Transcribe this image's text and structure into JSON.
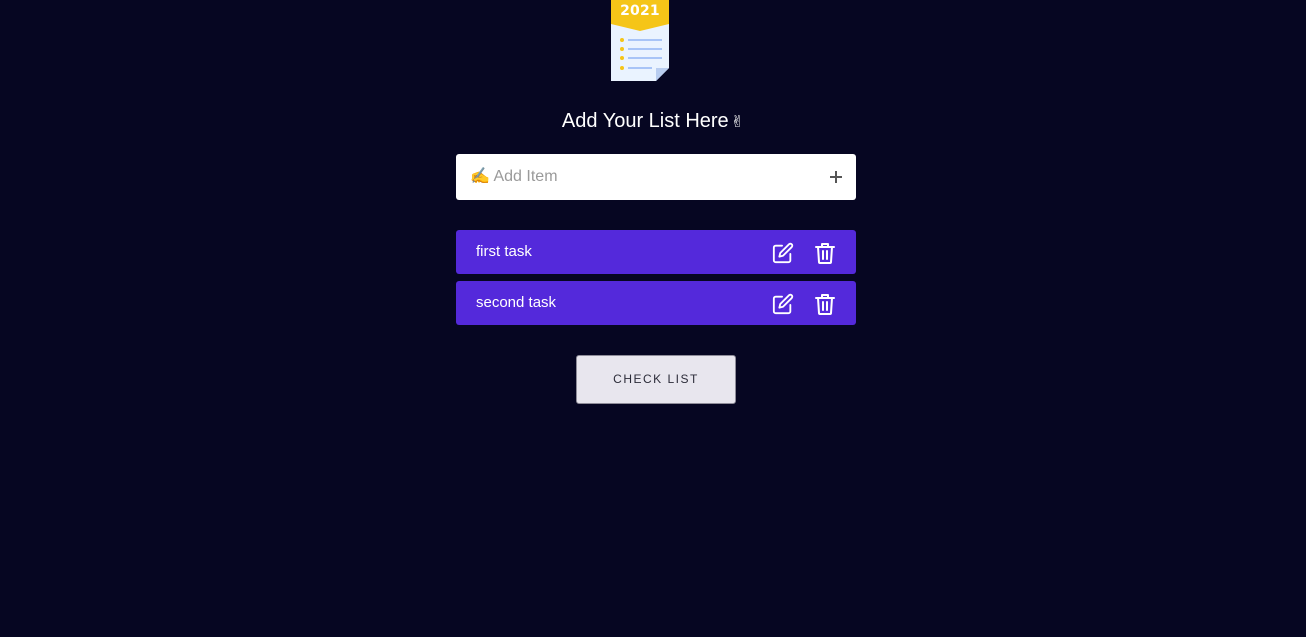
{
  "logo": {
    "year": "2021",
    "icon": "checklist-document-icon",
    "colors": {
      "banner": "#f5c518",
      "paper": "#eaf3ff",
      "lines": "#a8c4f7",
      "bullets": "#f5c518"
    }
  },
  "heading": {
    "text": "Add Your List Here",
    "emoji": "✌"
  },
  "add_item": {
    "placeholder": "✍ Add Item",
    "value": "",
    "add_icon": "plus-icon"
  },
  "tasks": [
    {
      "label": "first task",
      "edit_icon": "edit-icon",
      "delete_icon": "trash-icon"
    },
    {
      "label": "second task",
      "edit_icon": "edit-icon",
      "delete_icon": "trash-icon"
    }
  ],
  "check_list_button": {
    "label": "CHECK LIST"
  },
  "colors": {
    "background": "#060622",
    "task_background": "#5429db",
    "button_background": "#e8e6ee"
  }
}
